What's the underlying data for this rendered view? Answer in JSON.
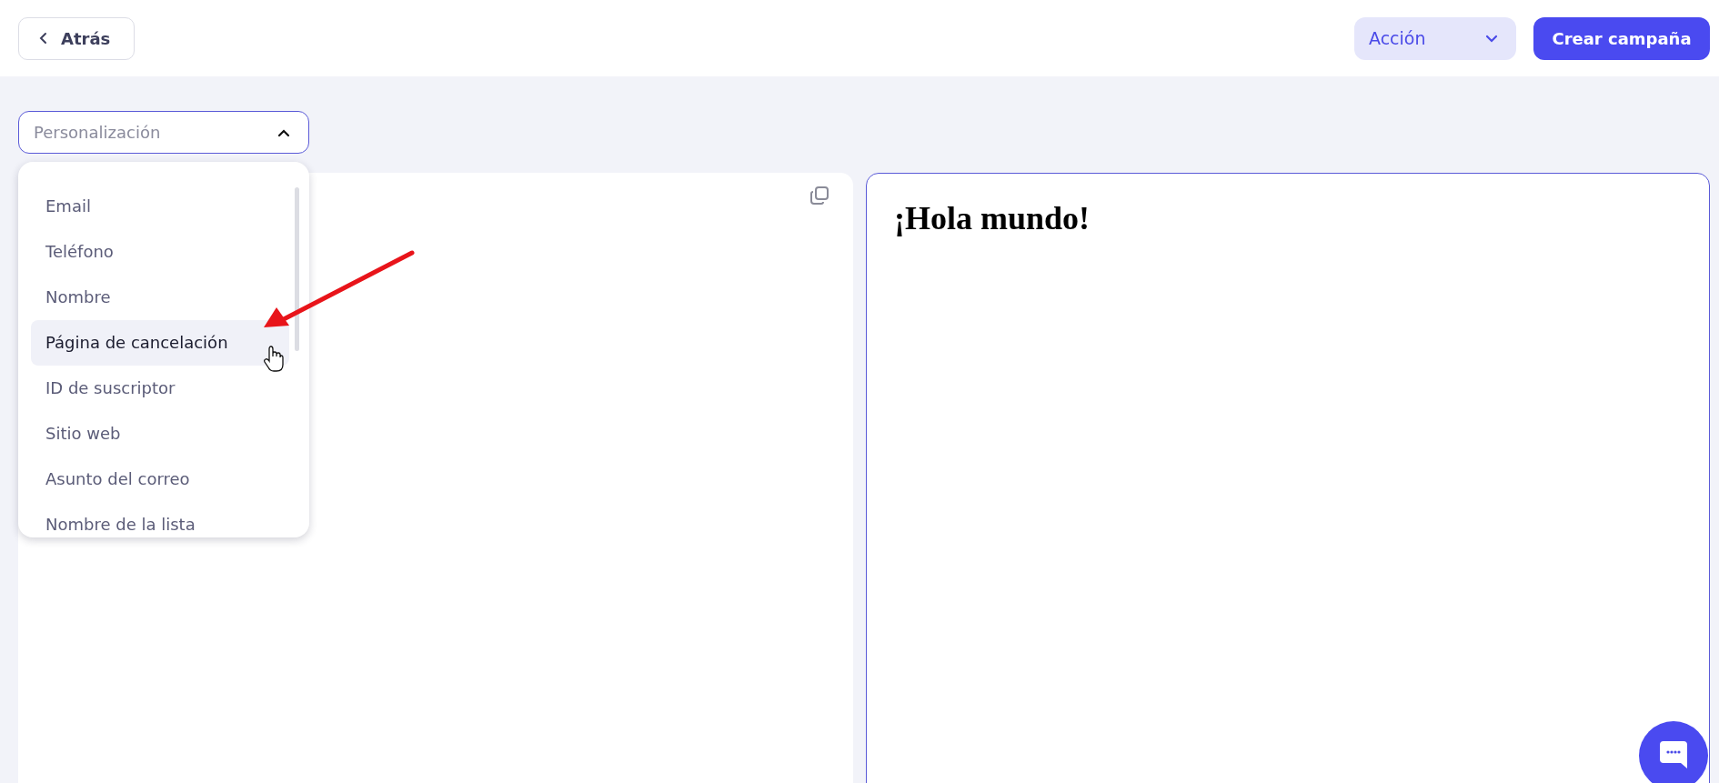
{
  "header": {
    "back_button": "Atrás",
    "action_menu": "Acción",
    "create_button": "Crear campaña"
  },
  "personalization": {
    "placeholder": "Personalización",
    "expanded": true,
    "options": [
      {
        "label": "Email",
        "selected": false
      },
      {
        "label": "Teléfono",
        "selected": false
      },
      {
        "label": "Nombre",
        "selected": false
      },
      {
        "label": "Página de cancelación",
        "selected": true
      },
      {
        "label": "ID de suscriptor",
        "selected": false
      },
      {
        "label": "Sitio web",
        "selected": false
      },
      {
        "label": "Asunto del correo",
        "selected": false
      },
      {
        "label": "Nombre de la lista",
        "selected": false
      }
    ]
  },
  "preview": {
    "heading": "¡Hola mundo!"
  }
}
